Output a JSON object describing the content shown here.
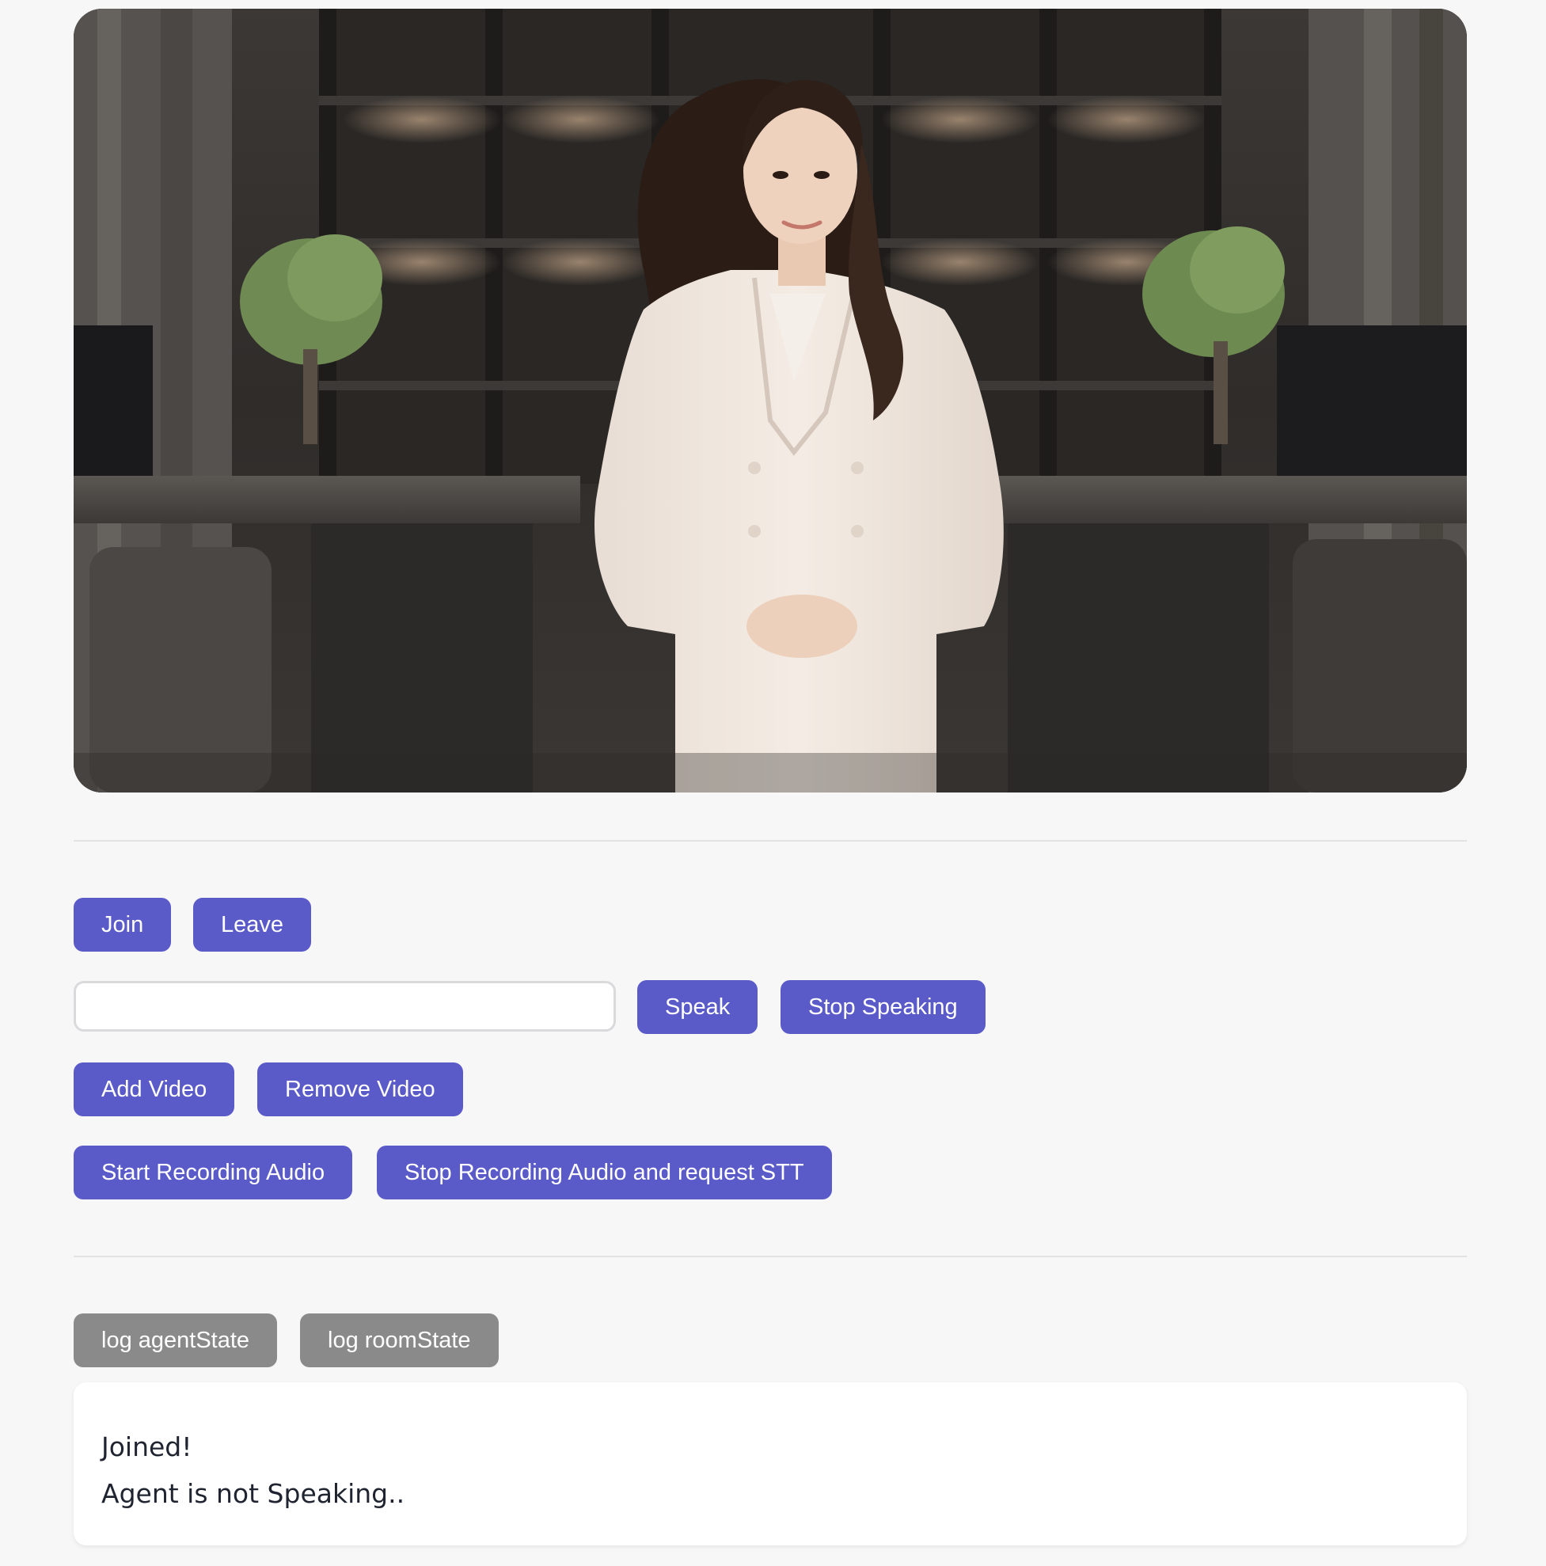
{
  "video": {
    "description_icon": "avatar-video-icon"
  },
  "controls": {
    "join_label": "Join",
    "leave_label": "Leave",
    "speak_input_value": "",
    "speak_label": "Speak",
    "stop_speaking_label": "Stop Speaking",
    "add_video_label": "Add Video",
    "remove_video_label": "Remove Video",
    "start_recording_label": "Start Recording Audio",
    "stop_recording_label": "Stop Recording Audio and request STT"
  },
  "debug": {
    "log_agent_state_label": "log agentState",
    "log_room_state_label": "log roomState"
  },
  "status": {
    "lines": [
      "Joined!",
      "Agent is not Speaking.."
    ]
  },
  "colors": {
    "primary_button": "#5a5bc9",
    "secondary_button": "#8a8a8a",
    "page_background": "#f7f7f8",
    "status_text": "#1f2430"
  }
}
